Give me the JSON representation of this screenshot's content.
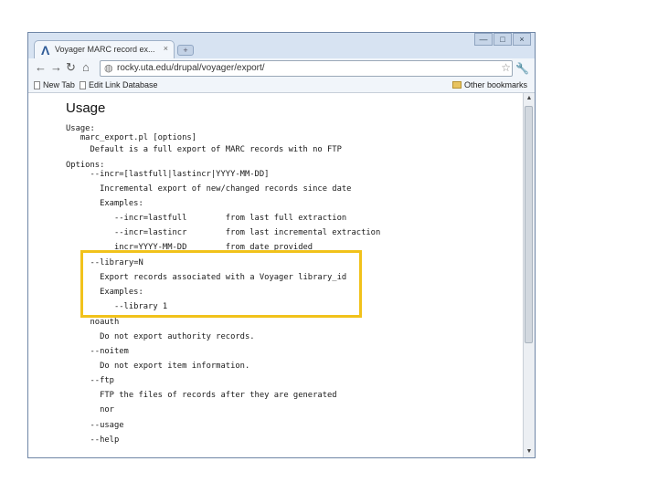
{
  "browser": {
    "tab_title": "Voyager MARC record ex...",
    "tab_close": "×",
    "new_tab": "+",
    "url": "rocky.uta.edu/drupal/voyager/export/",
    "bookmarks": [
      "New Tab",
      "Edit Link Database"
    ],
    "other_bookmarks": "Other bookmarks",
    "window_controls": [
      "—",
      "□",
      "×"
    ]
  },
  "page": {
    "heading": "Usage",
    "lines": [
      "Usage:",
      "   marc_export.pl [options]",
      "",
      "     Default is a full export of MARC records with no FTP",
      "",
      "Options:",
      "     --incr=[lastfull|lastincr|YYYY-MM-DD]",
      "       Incremental export of new/changed records since date",
      "       Examples:",
      "          --incr=lastfull        from last full extraction",
      "          --incr=lastincr        from last incremental extraction",
      "          incr=YYYY-MM-DD        from date provided",
      "     --library=N",
      "       Export records associated with a Voyager library_id",
      "       Examples:",
      "          --library 1",
      "     noauth",
      "       Do not export authority records.",
      "     --noitem",
      "       Do not export item information.",
      "     --ftp",
      "       FTP the files of records after they are generated",
      "       nor",
      "     --usage",
      "     --help"
    ]
  },
  "colors": {
    "highlight": "#f1c21b",
    "window_frame": "#d7e3f2"
  }
}
